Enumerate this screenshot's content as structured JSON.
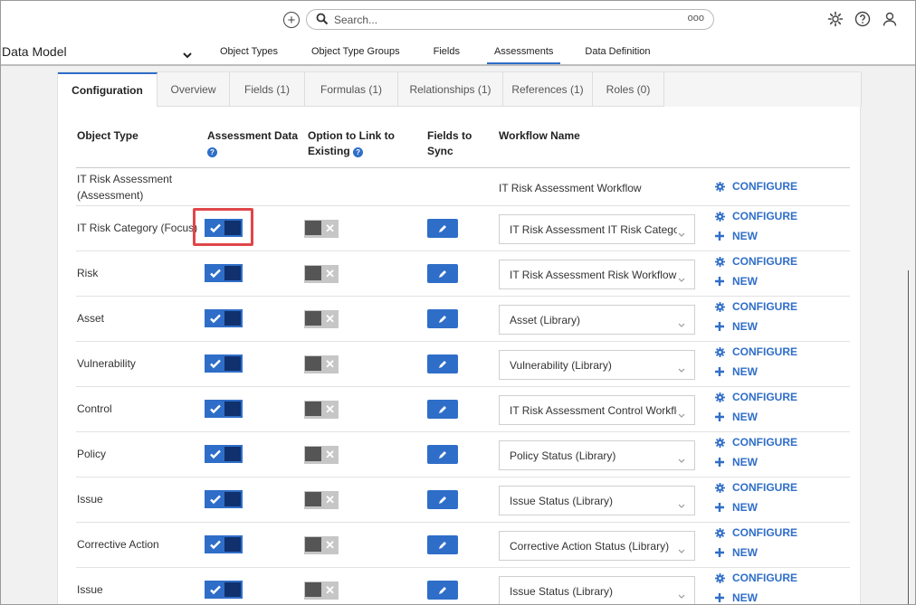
{
  "search": {
    "placeholder": "Search...",
    "more": "ooo"
  },
  "nav": {
    "title": "Data Model",
    "links": [
      "Object Types",
      "Object Type Groups",
      "Fields",
      "Assessments",
      "Data Definition"
    ],
    "active": "Assessments"
  },
  "tabs": [
    "Configuration",
    "Overview",
    "Fields (1)",
    "Formulas (1)",
    "Relationships (1)",
    "References (1)",
    "Roles (0)"
  ],
  "active_tab": "Configuration",
  "table": {
    "headers": {
      "object_type": "Object Type",
      "assessment_data": "Assessment Data",
      "link_existing_1": "Option to Link to",
      "link_existing_2": "Existing",
      "fields_sync_1": "Fields to",
      "fields_sync_2": "Sync",
      "workflow_name": "Workflow Name"
    },
    "first_row": {
      "object_type_1": "IT Risk Assessment",
      "object_type_2": "(Assessment)",
      "workflow": "IT Risk Assessment Workflow",
      "configure": "CONFIGURE"
    },
    "rows": [
      {
        "object_type": "IT Risk Category (Focus)",
        "workflow": "IT Risk Assessment IT Risk Category Workflow"
      },
      {
        "object_type": "Risk",
        "workflow": "IT Risk Assessment Risk Workflow"
      },
      {
        "object_type": "Asset",
        "workflow": "Asset (Library)"
      },
      {
        "object_type": "Vulnerability",
        "workflow": "Vulnerability (Library)"
      },
      {
        "object_type": "Control",
        "workflow": "IT Risk Assessment Control Workflow"
      },
      {
        "object_type": "Policy",
        "workflow": "Policy Status (Library)"
      },
      {
        "object_type": "Issue",
        "workflow": "Issue Status (Library)"
      },
      {
        "object_type": "Corrective Action",
        "workflow": "Corrective Action Status (Library)"
      },
      {
        "object_type": "Issue",
        "workflow": "Issue Status (Library)"
      }
    ],
    "configure_label": "CONFIGURE",
    "new_label": "NEW"
  },
  "colors": {
    "accent": "#2f6ec8",
    "toggle_knob": "#10306e",
    "highlight": "#e0464a"
  }
}
